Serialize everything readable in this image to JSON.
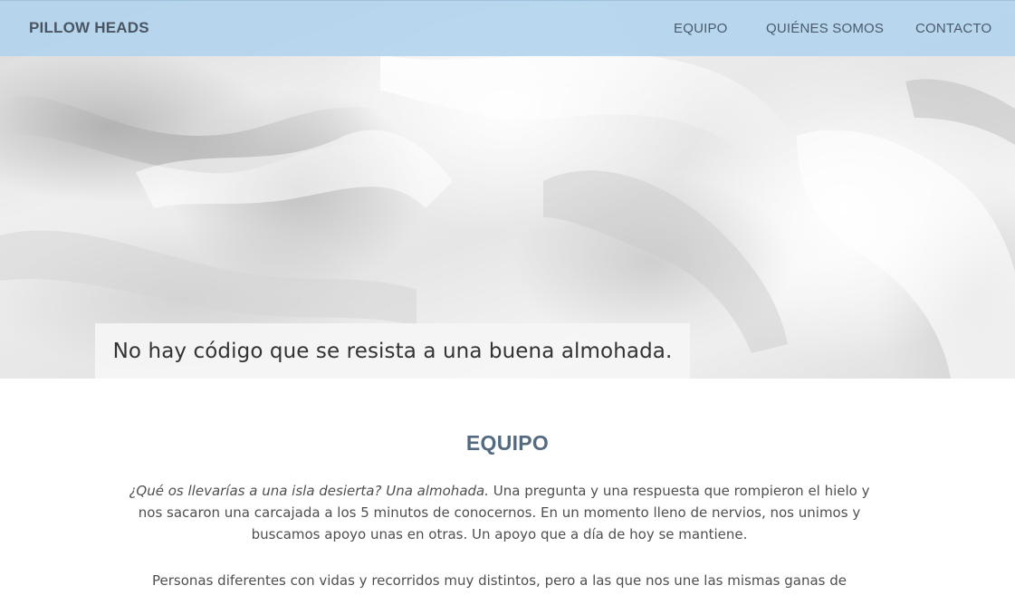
{
  "navbar": {
    "brand": "PILLOW HEADS",
    "links": [
      {
        "label": "EQUIPO"
      },
      {
        "label": "QUIÉNES SOMOS"
      },
      {
        "label": "CONTACTO"
      }
    ]
  },
  "hero": {
    "tagline": "No hay código que se resista a una buena almohada."
  },
  "team_section": {
    "title": "EQUIPO",
    "paragraph_1_italic": "¿Qué os llevarías a una isla desierta? Una almohada.",
    "paragraph_1_rest": " Una pregunta y una respuesta que rompieron el hielo y nos sacaron una carcajada a los 5 minutos de conocernos. En un momento lleno de nervios, nos unimos y buscamos apoyo unas en otras. Un apoyo que a día de hoy se mantiene.",
    "paragraph_2": "Personas diferentes con vidas y recorridos muy distintos, pero a las que nos une las mismas ganas de"
  },
  "colors": {
    "navbar_bg": "#b0d4ee",
    "brand_text": "#4a5563",
    "section_title": "#546a80",
    "body_text": "#4f4f4f"
  }
}
